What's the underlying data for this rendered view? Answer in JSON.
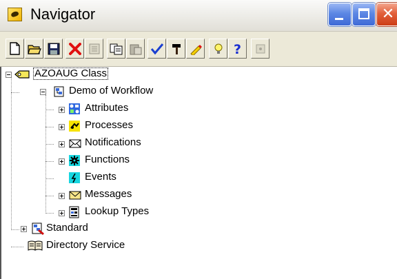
{
  "window": {
    "title": "Navigator"
  },
  "titlebar_buttons": [
    "minimize",
    "maximize",
    "close"
  ],
  "toolbar": [
    {
      "name": "new-icon"
    },
    {
      "name": "open-folder-icon"
    },
    {
      "name": "save-icon"
    },
    {
      "name": "delete-icon"
    },
    {
      "name": "properties-icon"
    },
    {
      "name": "copy-icon"
    },
    {
      "name": "paste-icon"
    },
    {
      "name": "verify-checkmark-icon"
    },
    {
      "name": "hammer-icon"
    },
    {
      "name": "pencil-icon"
    },
    {
      "name": "lightbulb-icon"
    },
    {
      "name": "help-icon"
    },
    {
      "name": "disabled-icon"
    }
  ],
  "tree": {
    "root": "AZOAUG Class",
    "workflow": "Demo of Workflow",
    "children": [
      "Attributes",
      "Processes",
      "Notifications",
      "Functions",
      "Events",
      "Messages",
      "Lookup Types"
    ],
    "standard": "Standard",
    "directory": "Directory Service"
  }
}
